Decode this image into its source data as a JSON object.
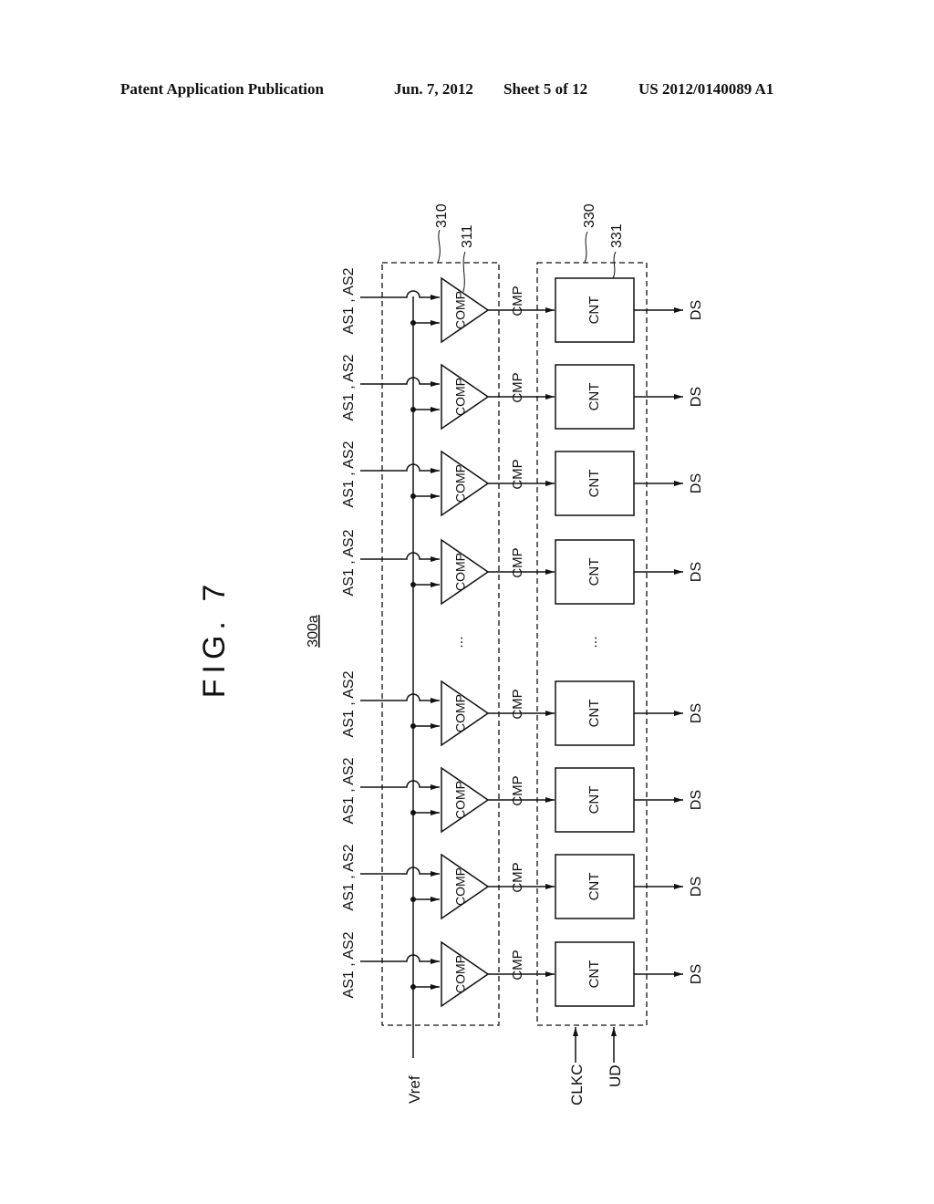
{
  "header": {
    "publication": "Patent Application Publication",
    "date": "Jun. 7, 2012",
    "sheet": "Sheet 5 of 12",
    "number": "US 2012/0140089 A1"
  },
  "figure": {
    "title": "FIG. 7",
    "ref": "300a",
    "comparator_block_ref": "310",
    "comparator_ref": "311",
    "counter_block_ref": "330",
    "counter_ref": "331",
    "ellipsis": "...",
    "vref_label": "Vref",
    "clock_label": "CLKC",
    "updown_label": "UD",
    "rows": [
      {
        "input": "AS1 , AS2",
        "comp": "COMP",
        "signal": "CMP",
        "counter": "CNT",
        "output": "DS"
      },
      {
        "input": "AS1 , AS2",
        "comp": "COMP",
        "signal": "CMP",
        "counter": "CNT",
        "output": "DS"
      },
      {
        "input": "AS1 , AS2",
        "comp": "COMP",
        "signal": "CMP",
        "counter": "CNT",
        "output": "DS"
      },
      {
        "input": "AS1 , AS2",
        "comp": "COMP",
        "signal": "CMP",
        "counter": "CNT",
        "output": "DS"
      },
      {
        "input": "AS1 , AS2",
        "comp": "COMP",
        "signal": "CMP",
        "counter": "CNT",
        "output": "DS"
      },
      {
        "input": "AS1 , AS2",
        "comp": "COMP",
        "signal": "CMP",
        "counter": "CNT",
        "output": "DS"
      },
      {
        "input": "AS1 , AS2",
        "comp": "COMP",
        "signal": "CMP",
        "counter": "CNT",
        "output": "DS"
      },
      {
        "input": "AS1 , AS2",
        "comp": "COMP",
        "signal": "CMP",
        "counter": "CNT",
        "output": "DS"
      }
    ]
  }
}
